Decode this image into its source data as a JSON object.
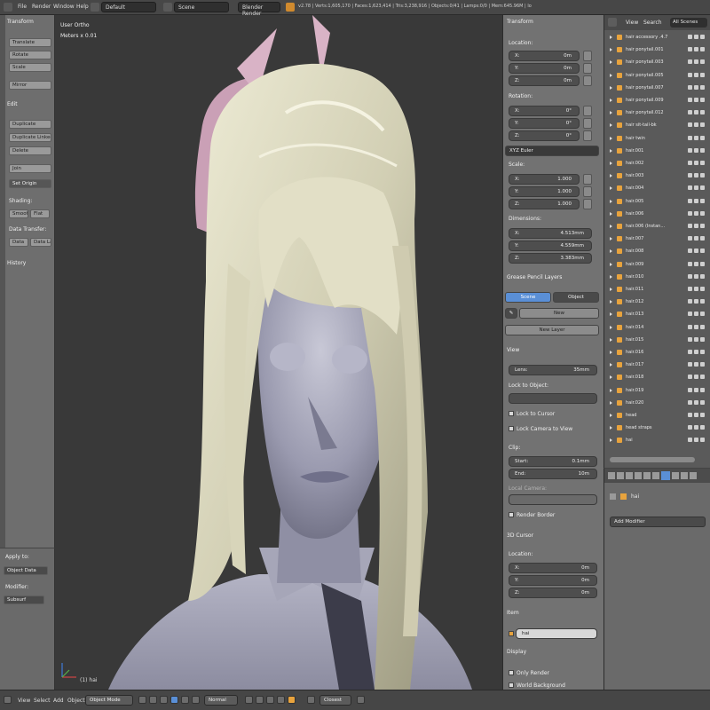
{
  "top_header": {
    "menus": [
      "File",
      "Render",
      "Window",
      "Help"
    ],
    "layout_select": "Default",
    "scene_select": "Scene",
    "engine_select": "Blender Render",
    "info_text": "v2.78 | Verts:1,605,170 | Faces:1,623,414 | Tris:3,238,916 | Objects:0/41 | Lamps:0/0 | Mem:645.96M | lo"
  },
  "toolshelf": {
    "transform_header": "Transform",
    "transform_buttons": [
      "Translate",
      "Rotate",
      "Scale",
      "Mirror"
    ],
    "edit_header": "Edit",
    "edit_buttons": [
      "Duplicate",
      "Duplicate Linked",
      "Delete",
      "Join"
    ],
    "set_origin": "Set Origin",
    "shading_label": "Shading:",
    "shading_smooth": "Smooth",
    "shading_flat": "Flat",
    "data_transfer_label": "Data Transfer:",
    "data_btn": "Data",
    "data_lay_btn": "Data Lay",
    "history_header": "History"
  },
  "operator_panel": {
    "header": "Apply to:",
    "object_data": "Object Data",
    "modifier_label": "Modifier:",
    "modifier_value": "Subsurf"
  },
  "viewport": {
    "view_label": "User Ortho",
    "units_label": "Meters x 0.01",
    "object_label": "(1) hai"
  },
  "properties": {
    "transform_header": "Transform",
    "location_label": "Location:",
    "location": [
      {
        "axis": "X:",
        "value": "0m"
      },
      {
        "axis": "Y:",
        "value": "0m"
      },
      {
        "axis": "Z:",
        "value": "0m"
      }
    ],
    "rotation_label": "Rotation:",
    "rotation": [
      {
        "axis": "X:",
        "value": "0°"
      },
      {
        "axis": "Y:",
        "value": "0°"
      },
      {
        "axis": "Z:",
        "value": "0°"
      }
    ],
    "rotation_mode": "XYZ Euler",
    "scale_label": "Scale:",
    "scale": [
      {
        "axis": "X:",
        "value": "1.000"
      },
      {
        "axis": "Y:",
        "value": "1.000"
      },
      {
        "axis": "Z:",
        "value": "1.000"
      }
    ],
    "dimensions_label": "Dimensions:",
    "dimensions": [
      {
        "axis": "X:",
        "value": "4.513mm"
      },
      {
        "axis": "Y:",
        "value": "4.559mm"
      },
      {
        "axis": "Z:",
        "value": "3.383mm"
      }
    ],
    "grease_header": "Grease Pencil Layers",
    "tab_scene": "Scene",
    "tab_object": "Object",
    "new_btn": "New",
    "new_layer_btn": "New Layer",
    "view_header": "View",
    "lens_label": "Lens:",
    "lens_value": "35mm",
    "lock_to_object": "Lock to Object:",
    "lock_to_cursor": "Lock to Cursor",
    "lock_camera": "Lock Camera to View",
    "clip_label": "Clip:",
    "clip_start_label": "Start:",
    "clip_start_value": "0.1mm",
    "clip_end_label": "End:",
    "clip_end_value": "10m",
    "local_camera": "Local Camera:",
    "render_border": "Render Border",
    "cursor_header": "3D Cursor",
    "cursor_location_label": "Location:",
    "cursor_location": [
      {
        "axis": "X:",
        "value": "0m"
      },
      {
        "axis": "Y:",
        "value": "0m"
      },
      {
        "axis": "Z:",
        "value": "0m"
      }
    ],
    "item_header": "Item",
    "item_name": "hai",
    "display_header": "Display",
    "only_render": "Only Render",
    "world_background": "World Background"
  },
  "outliner": {
    "view_menu": "View",
    "search_menu": "Search",
    "scene_select": "All Scenes",
    "items": [
      "hair accessory .4.7",
      "hair ponytail.001",
      "hair ponytail.003",
      "hair ponytail.005",
      "hair ponytail.007",
      "hair ponytail.009",
      "hair ponytail.012",
      "hair sit-tail-bk",
      "hair twin",
      "hair.001",
      "hair.002",
      "hair.003",
      "hair.004",
      "hair.005",
      "hair.006",
      "hair.006 (Instan...",
      "hair.007",
      "hair.008",
      "hair.009",
      "hair.010",
      "hair.011",
      "hair.012",
      "hair.013",
      "hair.014",
      "hair.015",
      "hair.016",
      "hair.017",
      "hair.018",
      "hair.019",
      "hair.020",
      "head",
      "head straps",
      "hai"
    ]
  },
  "modifier_panel": {
    "object_name": "hai",
    "add_modifier": "Add Modifier"
  },
  "bottom_bar": {
    "menus": [
      "View",
      "Select",
      "Add",
      "Object"
    ],
    "mode_select": "Object Mode",
    "pivot_select": "Normal",
    "snap_select": "Closest"
  },
  "colors": {
    "viewport_bg": "#393939",
    "hair": "#d9d6bf",
    "skin": "#a2a2b5",
    "accessory_pink": "#caa0b6",
    "highlight_blue": "#5a8fd6"
  }
}
